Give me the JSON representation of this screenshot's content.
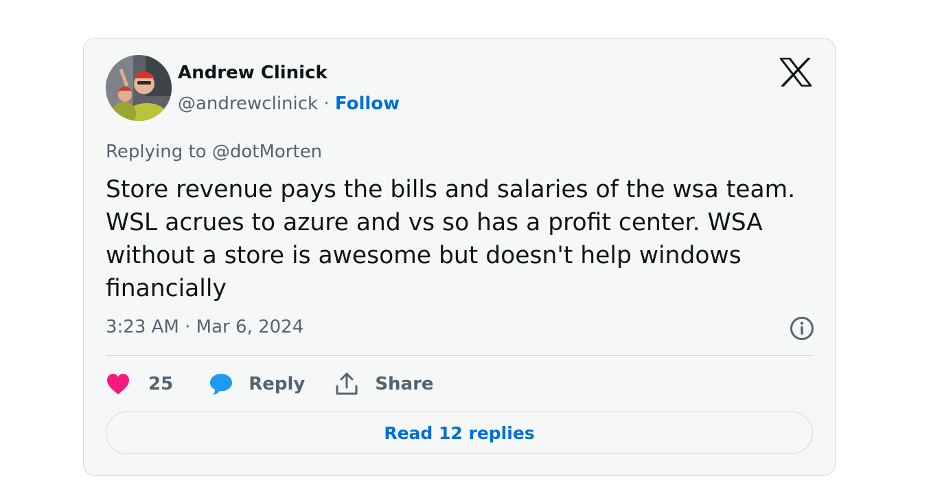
{
  "author": {
    "name": "Andrew Clinick",
    "handle": "@andrewclinick",
    "separator": "·",
    "follow_label": "Follow",
    "avatar": "profile-photo"
  },
  "platform_logo": "x-logo-icon",
  "reply_context": {
    "prefix": "Replying to",
    "target": "@dotMorten"
  },
  "tweet": {
    "text": "Store revenue pays the bills and salaries of the wsa team. WSL acrues to azure and vs so has a profit center. WSA without a store is awesome but doesn't help windows financially",
    "time": "3:23 AM",
    "date": "Mar 6, 2024",
    "separator": "·"
  },
  "actions": {
    "like": {
      "icon": "heart-icon",
      "count": "25"
    },
    "reply": {
      "icon": "speech-bubble-icon",
      "label": "Reply"
    },
    "share": {
      "icon": "share-upload-icon",
      "label": "Share"
    }
  },
  "info_icon": "info-icon",
  "read_replies_label": "Read 12 replies",
  "colors": {
    "link": "#006fd6",
    "like": "#f91880",
    "reply": "#1d9bf0",
    "muted": "#536471",
    "text": "#0f1419",
    "card_bg": "#f6f7f7",
    "border": "#cfd9de"
  }
}
